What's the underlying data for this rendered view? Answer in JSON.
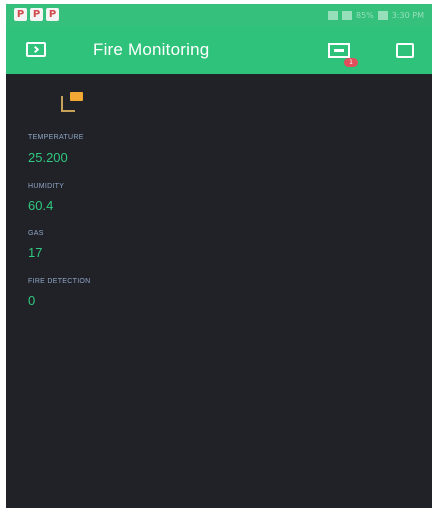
{
  "status_bar": {
    "notification_icons": [
      "P",
      "P",
      "P"
    ],
    "time_text": "3:30 PM",
    "battery_text": "85%"
  },
  "app_bar": {
    "title": "Fire Monitoring",
    "left_icon": "project-menu-icon",
    "device_icon": "device-icon",
    "device_badge": "1",
    "right_icon": "play-icon"
  },
  "widgets": [
    {
      "label": "TEMPERATURE",
      "value": "25.200"
    },
    {
      "label": "HUMIDITY",
      "value": "60.4"
    },
    {
      "label": "GAS",
      "value": "17"
    },
    {
      "label": "FIRE DETECTION",
      "value": "0"
    }
  ],
  "colors": {
    "header": "#2ec27a",
    "background": "#212227",
    "value": "#2fc87f",
    "label": "#8fa7c9",
    "widget_badge": "#f2a832"
  }
}
